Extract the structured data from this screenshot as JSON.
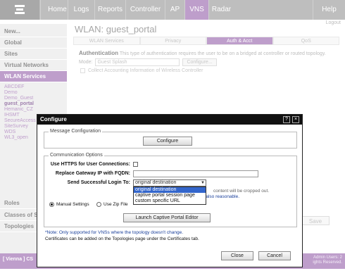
{
  "nav": {
    "logo": "e-logo-icon",
    "items": [
      "Home",
      "Logs",
      "Reports",
      "Controller",
      "AP",
      "VNS",
      "Radar"
    ],
    "active_index": 5,
    "help": "Help",
    "logout": "Logout"
  },
  "sidebar": {
    "new": "New...",
    "global": "Global",
    "sites": "Sites",
    "virtual_networks": "Virtual Networks",
    "wlan_services": "WLAN Services",
    "services": [
      "ABCDEF",
      "Demo",
      "Demo_Guest",
      "guest_portal",
      "Hemanic_CZ",
      "IHSMT",
      "SecureAccess",
      "SiteSurvey",
      "WDS",
      "WL3_open"
    ],
    "current_service_index": 3,
    "roles": "Roles",
    "classes_of_service": "Classes of S",
    "topologies": "Topologies"
  },
  "main": {
    "title": "WLAN: guest_portal",
    "tabs": [
      "WLAN Services",
      "Privacy",
      "Auth & Acct",
      "QoS"
    ],
    "active_tab_index": 2,
    "auth_label": "Authentication",
    "auth_desc": "This type of authentication requires the user to be on a bridged at controller or routed topology.",
    "mode_label": "Mode:",
    "mode_value": "Guest Splash",
    "configure_btn": "Configure...",
    "collect_accounting": "Collect Accounting Information of Wireless Controller",
    "save_btn": "Save"
  },
  "footer": {
    "left": "[ Vienna ] CS",
    "right_line1": "Admin Users: 2",
    "right_line2": "ights Reserved."
  },
  "dialog": {
    "title": "Configure",
    "help_icon": "?",
    "close_icon": "×",
    "message_config": {
      "legend": "Message Configuration",
      "configure_btn": "Configure"
    },
    "comm_options": {
      "legend": "Communication Options",
      "use_https_label": "Use HTTPS for User Connections:",
      "replace_gateway_label": "Replace Gateway IP with FQDN:",
      "replace_gateway_value": "",
      "send_login_label": "Send Successful Login To:",
      "send_login_value": "original destination",
      "send_login_options": [
        "original destination",
        "captive portal session page",
        "custom specific URL"
      ],
      "send_login_selected_index": 0,
      "crop_note_1": "content will be cropped out.",
      "crop_note_2": "Please make sure that the height is also reasonable.",
      "manual_settings": "Manual Settings",
      "use_zip_file": "Use Zip File",
      "launch_btn": "Launch Captive Portal Editor"
    },
    "note_vns": "*Note: Only supported for VNSs where the topology doesn't change.",
    "note_certs": "Certificates can be added on the Topologies page under the Certificates tab.",
    "close_btn": "Close",
    "cancel_btn": "Cancel"
  }
}
